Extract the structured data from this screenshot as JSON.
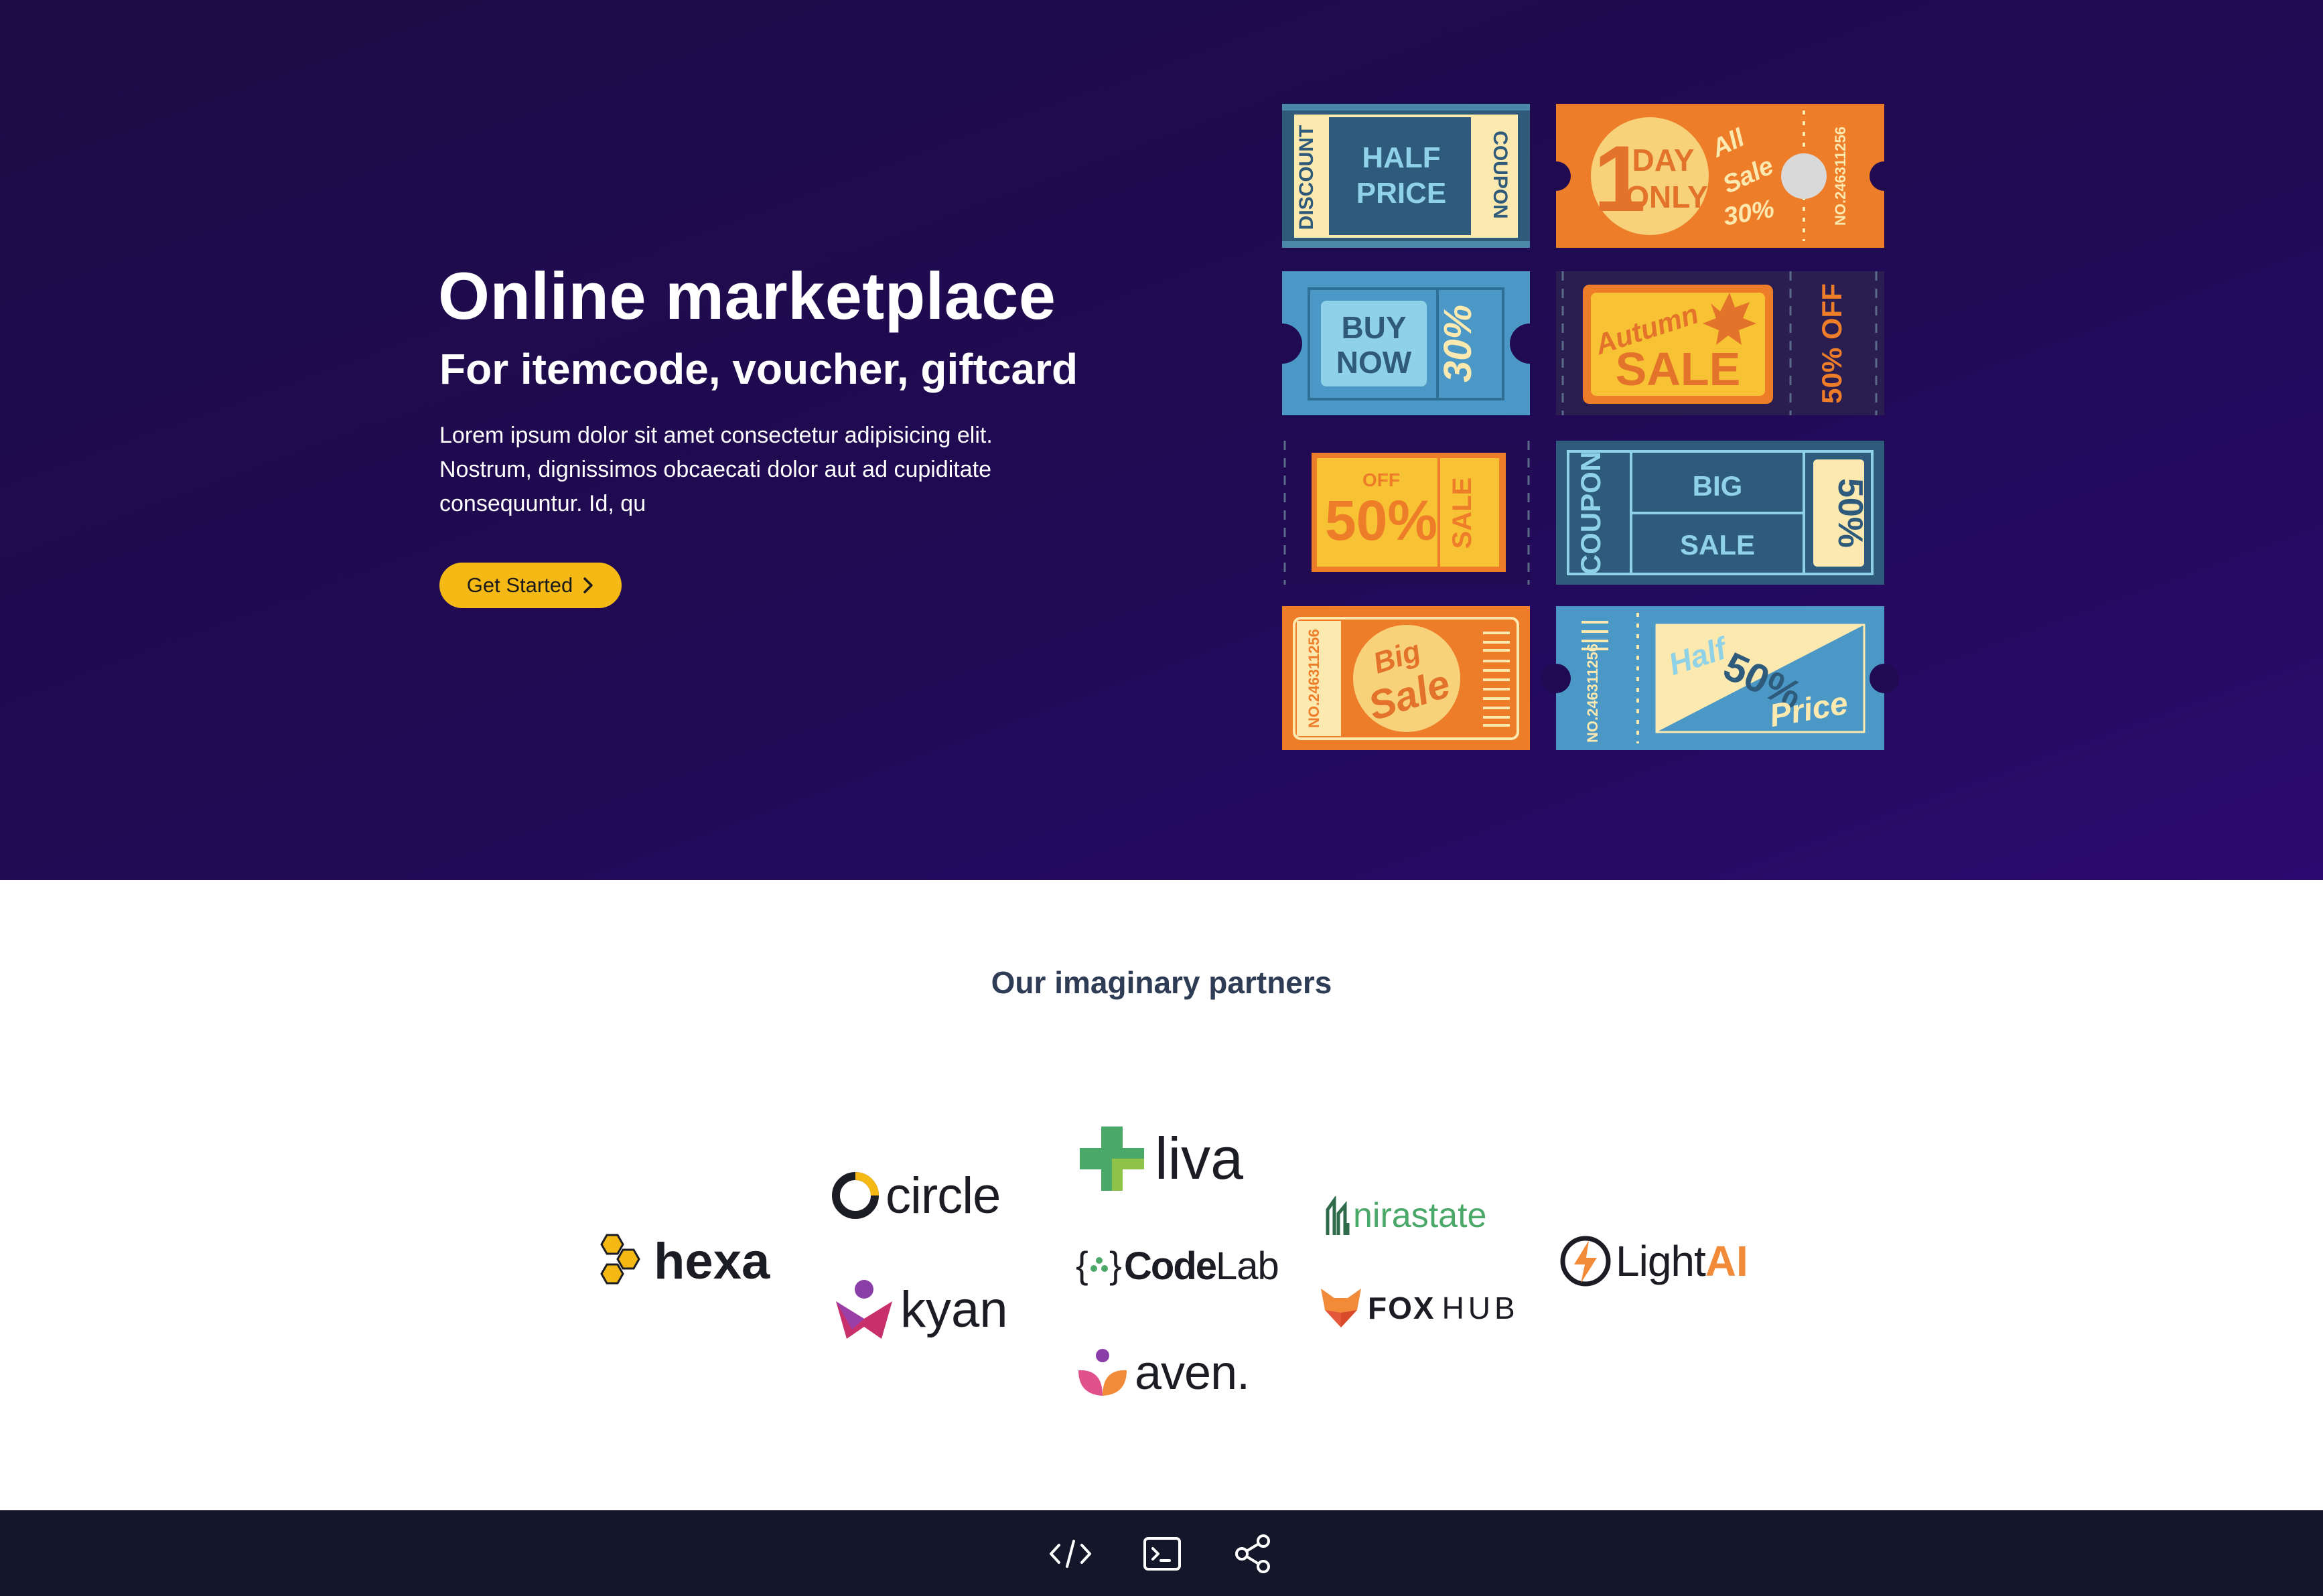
{
  "hero": {
    "title": "Online marketplace",
    "subtitle": "For itemcode, voucher, giftcard",
    "description_line1": "Lorem ipsum dolor sit amet consectetur adipisicing elit.",
    "description_line2": "Nostrum, dignissimos obcaecati dolor aut ad cupiditate",
    "description_line3": "consequuntur. Id, qu",
    "cta_label": "Get Started",
    "cta_icon": "chevron-right-icon",
    "background": "#200a52",
    "accent": "#f5b916"
  },
  "coupons": {
    "c1": {
      "left": "DISCOUNT",
      "line1": "HALF",
      "line2": "PRICE",
      "right": "COUPON"
    },
    "c2": {
      "number": "1",
      "line1": "DAY",
      "line2": "ONLY",
      "script1": "All",
      "script2": "Sale",
      "percent": "30%",
      "serial": "NO.246311256"
    },
    "c3": {
      "line1": "BUY",
      "line2": "NOW",
      "percent": "30%"
    },
    "c4": {
      "script": "Autumn",
      "main": "SALE",
      "side": "50% OFF"
    },
    "c5": {
      "small": "OFF",
      "main": "50%",
      "side": "SALE"
    },
    "c6": {
      "left": "COUPON",
      "line1": "BIG",
      "line2": "SALE",
      "right": "50%"
    },
    "c7": {
      "serial": "NO.246311256",
      "script1": "Big",
      "script2": "Sale"
    },
    "c8": {
      "serial": "NO.246311256",
      "script1": "Half",
      "percent": "50%",
      "script2": "Price"
    }
  },
  "partners": {
    "title": "Our imaginary partners",
    "logos": {
      "hexa": "hexa",
      "circle": "circle",
      "kyan": "kyan",
      "liva": "liva",
      "codelab_code": "Code",
      "codelab_lab": "Lab",
      "aven": "aven.",
      "nirastate": "nirastate",
      "foxhub_fox": "FOX",
      "foxhub_hub": "HUB",
      "lightai_light": "Light",
      "lightai_ai": "AI"
    }
  },
  "footer": {
    "icons": [
      "code-icon",
      "terminal-icon",
      "share-icon"
    ],
    "background": "#141629"
  }
}
